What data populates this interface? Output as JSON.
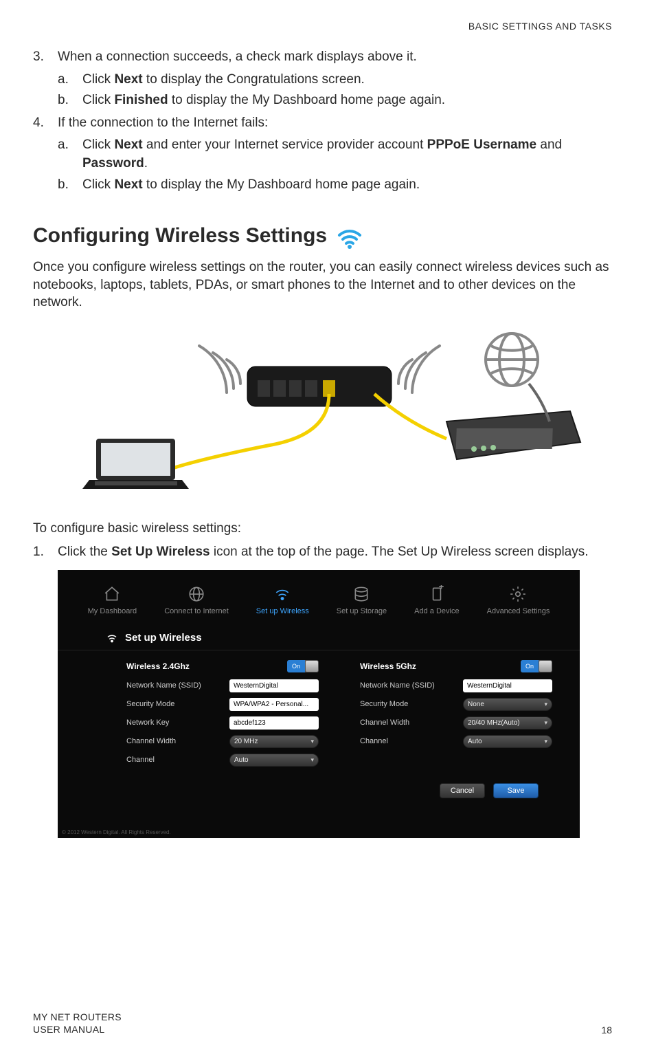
{
  "header": {
    "section": "BASIC SETTINGS AND TASKS"
  },
  "steps": {
    "s3": {
      "num": "3.",
      "text": "When a connection succeeds, a check mark displays above it.",
      "a": {
        "letter": "a.",
        "pre": "Click ",
        "bold": "Next",
        "post": " to display the Congratulations screen."
      },
      "b": {
        "letter": "b.",
        "pre": "Click ",
        "bold": "Finished",
        "post": " to display the My Dashboard home page again."
      }
    },
    "s4": {
      "num": "4.",
      "text": "If the connection to the Internet fails:",
      "a": {
        "letter": "a.",
        "pre": "Click ",
        "bold1": "Next",
        "mid": " and enter your Internet service provider account ",
        "bold2": "PPPoE Username",
        "and": " and ",
        "bold3": "Password",
        "post": "."
      },
      "b": {
        "letter": "b.",
        "pre": "Click ",
        "bold": "Next",
        "post": " to display the My Dashboard home page again."
      }
    }
  },
  "h2": "Configuring Wireless Settings",
  "intro": "Once you configure wireless settings on the router, you can easily connect wireless devices such as notebooks, laptops, tablets, PDAs, or smart phones to the Internet and to other devices on the network.",
  "subhead": "To configure basic wireless settings:",
  "step1": {
    "num": "1.",
    "pre": "Click the ",
    "bold": "Set Up Wireless",
    "post": " icon at the top of the page. The Set Up Wireless screen displays."
  },
  "ui": {
    "nav": {
      "dashboard": "My Dashboard",
      "connect": "Connect to Internet",
      "wireless": "Set up Wireless",
      "storage": "Set up Storage",
      "device": "Add a Device",
      "advanced": "Advanced Settings"
    },
    "panel_title": "Set up Wireless",
    "col24": {
      "title": "Wireless 2.4Ghz",
      "toggle": "On",
      "ssid_label": "Network Name (SSID)",
      "ssid_value": "WesternDigital",
      "sec_label": "Security Mode",
      "sec_value": "WPA/WPA2 - Personal...",
      "key_label": "Network Key",
      "key_value": "abcdef123",
      "cw_label": "Channel Width",
      "cw_value": "20 MHz",
      "ch_label": "Channel",
      "ch_value": "Auto"
    },
    "col5": {
      "title": "Wireless 5Ghz",
      "toggle": "On",
      "ssid_label": "Network Name (SSID)",
      "ssid_value": "WesternDigital",
      "sec_label": "Security Mode",
      "sec_value": "None",
      "cw_label": "Channel Width",
      "cw_value": "20/40 MHz(Auto)",
      "ch_label": "Channel",
      "ch_value": "Auto"
    },
    "cancel": "Cancel",
    "save": "Save",
    "copyright": "© 2012 Western Digital. All Rights Reserved."
  },
  "footer": {
    "line1": "MY NET ROUTERS",
    "line2": "USER MANUAL",
    "page": "18"
  }
}
